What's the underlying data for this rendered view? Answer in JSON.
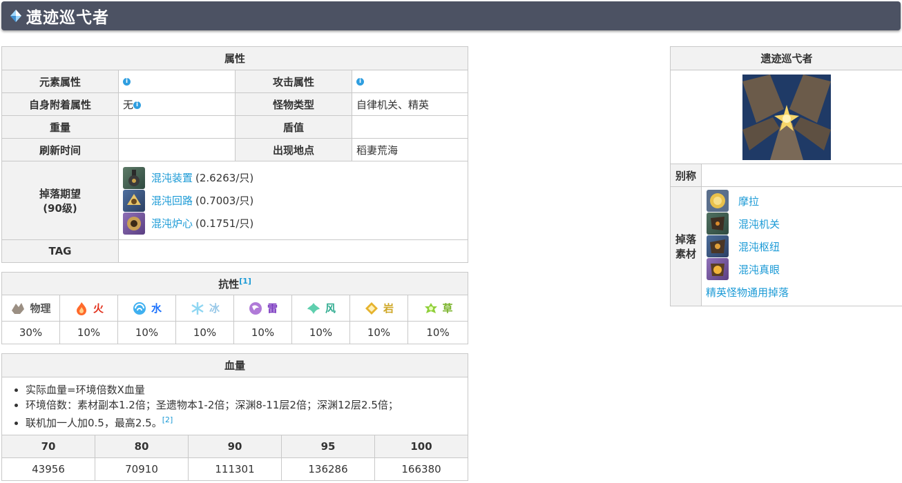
{
  "header": {
    "title": "遗迹巡弋者"
  },
  "attributes": {
    "section_title": "属性",
    "element_label": "元素属性",
    "attack_label": "攻击属性",
    "self_attach_label": "自身附着属性",
    "self_attach_value": "无",
    "monster_type_label": "怪物类型",
    "monster_type_value": "自律机关、精英",
    "weight_label": "重量",
    "shield_label": "盾值",
    "refresh_label": "刷新时间",
    "location_label": "出现地点",
    "location_value": "稻妻荒海",
    "drops_label": "掉落期望",
    "drops_level": "(90级)",
    "drops": [
      {
        "name": "混沌装置",
        "rate": "(2.6263/只)"
      },
      {
        "name": "混沌回路",
        "rate": "(0.7003/只)"
      },
      {
        "name": "混沌炉心",
        "rate": "(0.1751/只)"
      }
    ],
    "tag_label": "TAG"
  },
  "resistance": {
    "section_title": "抗性",
    "footnote": "[1]",
    "items": [
      {
        "name": "物理",
        "value": "30%",
        "color": "#555555",
        "icon": "physical-icon"
      },
      {
        "name": "火",
        "value": "10%",
        "color": "#e2311d",
        "icon": "pyro-icon"
      },
      {
        "name": "水",
        "value": "10%",
        "color": "#1c72fd",
        "icon": "hydro-icon"
      },
      {
        "name": "冰",
        "value": "10%",
        "color": "#98c8e8",
        "icon": "cryo-icon"
      },
      {
        "name": "雷",
        "value": "10%",
        "color": "#7b3ac0",
        "icon": "electro-icon"
      },
      {
        "name": "风",
        "value": "10%",
        "color": "#33ad92",
        "icon": "anemo-icon"
      },
      {
        "name": "岩",
        "value": "10%",
        "color": "#cfa726",
        "icon": "geo-icon"
      },
      {
        "name": "草",
        "value": "10%",
        "color": "#7bb42d",
        "icon": "dendro-icon"
      }
    ]
  },
  "hp": {
    "section_title": "血量",
    "notes": [
      "实际血量=环境倍数X血量",
      "环境倍数：素材副本1.2倍；圣遗物本1-2倍；深渊8-11层2倍；深渊12层2.5倍；",
      "联机加一人加0.5，最高2.5。"
    ],
    "note3_footnote": "[2]",
    "levels": [
      "70",
      "80",
      "90",
      "95",
      "100"
    ],
    "values": [
      "43956",
      "70910",
      "111301",
      "136286",
      "166380"
    ]
  },
  "side": {
    "title": "遗迹巡弋者",
    "alias_label": "别称",
    "materials_label_1": "掉落",
    "materials_label_2": "素材",
    "materials": [
      "摩拉",
      "混沌机关",
      "混沌枢纽",
      "混沌真眼"
    ],
    "materials_link": "精英怪物通用掉落"
  }
}
